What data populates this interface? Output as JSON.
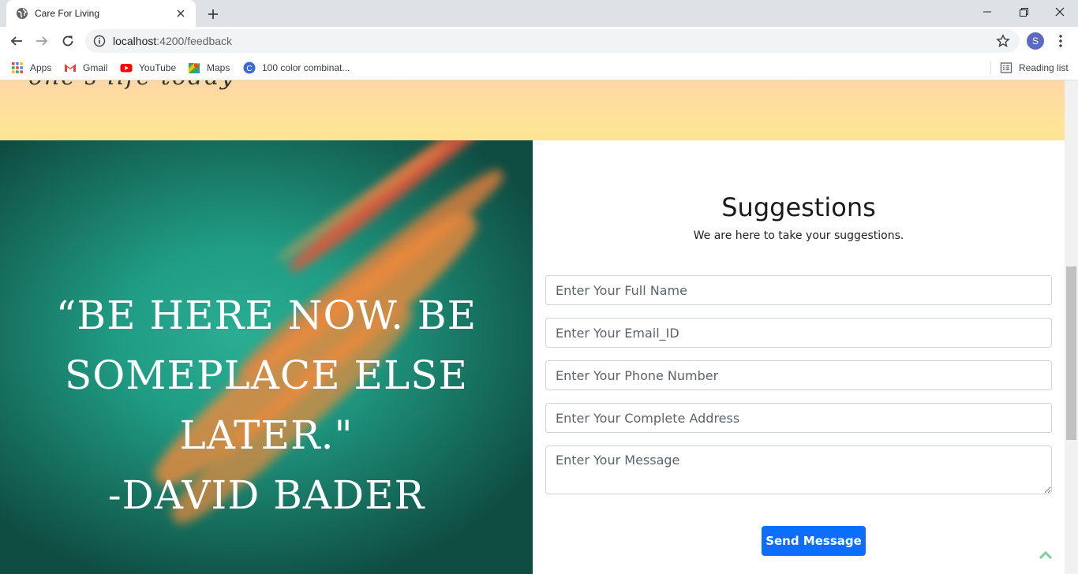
{
  "browser": {
    "tab_title": "Care For Living",
    "url_host": "localhost",
    "url_path": ":4200/feedback",
    "profile_initial": "S",
    "bookmarks": [
      {
        "label": "Apps",
        "icon": "apps-grid-icon"
      },
      {
        "label": "Gmail",
        "icon": "gmail-icon"
      },
      {
        "label": "YouTube",
        "icon": "youtube-icon"
      },
      {
        "label": "Maps",
        "icon": "maps-icon"
      },
      {
        "label": "100 color combinat...",
        "icon": "color-site-icon"
      }
    ],
    "reading_list": "Reading list"
  },
  "page": {
    "banner": {
      "heading_fragment": "one's life today"
    },
    "quote": {
      "line1": "“Be here now. Be",
      "line2": "someplace else later.\"",
      "line3": "-David Bader"
    },
    "form": {
      "title": "Suggestions",
      "subtitle": "We are here to take your suggestions.",
      "name_placeholder": "Enter Your Full Name",
      "email_placeholder": "Enter Your Email_ID",
      "phone_placeholder": "Enter Your Phone Number",
      "address_placeholder": "Enter Your Complete Address",
      "message_placeholder": "Enter Your Message",
      "submit_label": "Send Message"
    }
  },
  "colors": {
    "banner": "#fde497",
    "quote_bg": "#209c84",
    "accent_orange": "#f08a3c",
    "button": "#0d6efd",
    "scroll_top_arrow": "#7ccf9a"
  }
}
